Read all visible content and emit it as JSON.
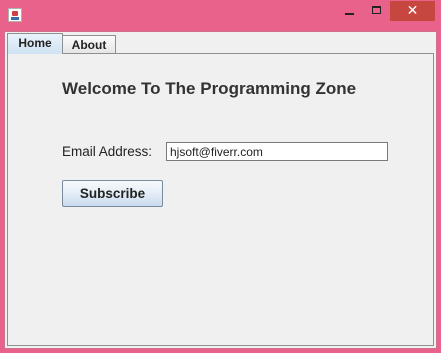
{
  "window": {
    "close_glyph": "✕",
    "icons": {
      "app": "java-cup-icon",
      "minimize": "minimize-icon",
      "maximize": "maximize-icon",
      "close": "close-icon"
    },
    "colors": {
      "frame": "#e8628c",
      "close_button": "#c7463f",
      "client_background": "#f0f0f0"
    }
  },
  "tabs": [
    {
      "label": "Home",
      "active": true
    },
    {
      "label": "About",
      "active": false
    }
  ],
  "home": {
    "heading": "Welcome To The Programming Zone",
    "email_label": "Email Address:",
    "email_value": "hjsoft@fiverr.com",
    "subscribe_label": "Subscribe"
  }
}
